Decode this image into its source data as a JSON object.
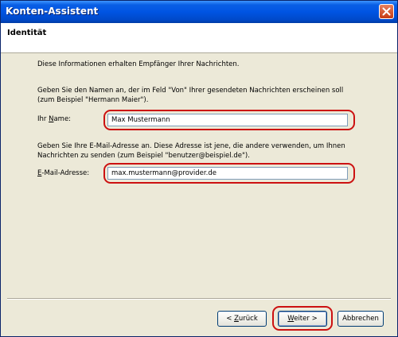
{
  "window": {
    "title": "Konten-Assistent"
  },
  "header": {
    "title": "Identität"
  },
  "content": {
    "intro": "Diese Informationen erhalten Empfänger Ihrer Nachrichten.",
    "name_help_line1": "Geben Sie den Namen an, der im Feld \"Von\" Ihrer gesendeten Nachrichten erscheinen soll",
    "name_help_line2": "(zum Beispiel \"Hermann Maier\").",
    "name_label_pre": "Ihr ",
    "name_label_access": "N",
    "name_label_post": "ame:",
    "name_value": "Max Mustermann",
    "email_help_line1": "Geben Sie Ihre E-Mail-Adresse an. Diese Adresse ist jene, die andere verwenden, um Ihnen",
    "email_help_line2": "Nachrichten zu senden (zum Beispiel \"benutzer@beispiel.de\").",
    "email_label_access": "E",
    "email_label_post": "-Mail-Adresse:",
    "email_value": "max.mustermann@provider.de"
  },
  "buttons": {
    "back_pre": "< ",
    "back_access": "Z",
    "back_post": "urück",
    "next_access": "W",
    "next_post": "eiter >",
    "cancel": "Abbrechen"
  },
  "colors": {
    "title_bar": "#0054e3",
    "highlight_ring": "#cc1111",
    "dialog_bg": "#ece9d8"
  },
  "icons": {
    "close": "close-icon"
  }
}
